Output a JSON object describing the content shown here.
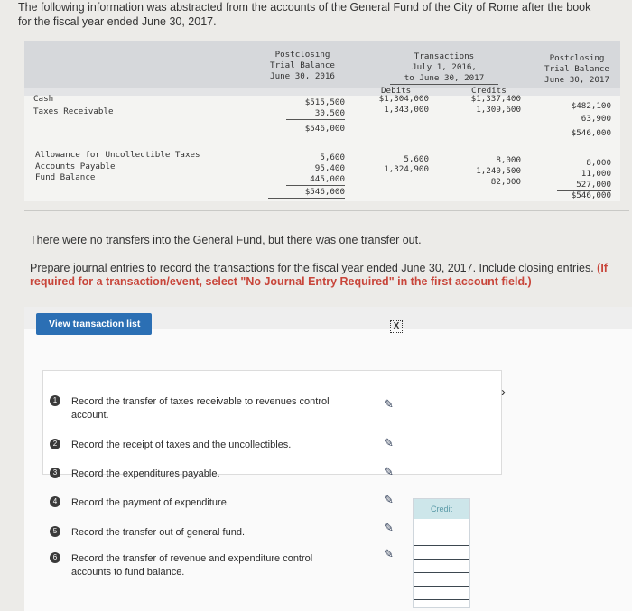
{
  "intro": {
    "line1": "The following information was abstracted from the accounts of the General Fund of the City of Rome after the book",
    "line2": "for the fiscal year ended June 30, 2017."
  },
  "trial_balance": {
    "head_left": [
      "Postclosing",
      "Trial Balance",
      "June 30, 2016"
    ],
    "head_mid": [
      "Transactions",
      "July 1, 2016,",
      "to June 30, 2017"
    ],
    "head_right": [
      "Postclosing",
      "Trial Balance",
      "June 30, 2017"
    ],
    "debits": "Debits",
    "credits": "Credits",
    "rows": [
      {
        "label": "Cash",
        "pre": "$515,500",
        "dr": "$1,304,000",
        "cr": "$1,337,400",
        "post": "$482,100"
      },
      {
        "label": "Taxes Receivable",
        "pre": "30,500",
        "dr": "1,343,000",
        "cr": "1,309,600",
        "post": "63,900"
      },
      {
        "label": "",
        "pre": "$546,000",
        "dr": "",
        "cr": "",
        "post": "$546,000"
      },
      {
        "label": "Allowance for Uncollectible Taxes",
        "pre": "5,600",
        "dr": "5,600",
        "cr": "8,000",
        "post": "8,000"
      },
      {
        "label": "Accounts Payable",
        "pre": "95,400",
        "dr": "1,324,900",
        "cr": "1,240,500",
        "post": "11,000"
      },
      {
        "label": "Fund Balance",
        "pre": "445,000",
        "dr": "",
        "cr": "82,000",
        "post": "527,000"
      },
      {
        "label": "",
        "pre": "$546,000",
        "dr": "",
        "cr": "",
        "post": "$546,000"
      }
    ]
  },
  "para1": "There were no transfers into the General Fund, but there was one transfer out.",
  "para2_text": "Prepare journal entries to record the transactions for the fiscal year ended June 30, 2017. Include closing entries.",
  "para2_bold": "(If required for a transaction/event, select \"No Journal Entry Required\" in the first account field.)",
  "panel": {
    "view_button": "View transaction list",
    "close_icon": "X",
    "credit_label": "Credit",
    "items": [
      {
        "num": "1",
        "text": "Record the transfer of taxes receivable to revenues control account."
      },
      {
        "num": "2",
        "text": "Record the receipt of taxes and the uncollectibles."
      },
      {
        "num": "3",
        "text": "Record the expenditures payable."
      },
      {
        "num": "4",
        "text": "Record the payment of expenditure."
      },
      {
        "num": "5",
        "text": "Record the transfer out of general fund."
      },
      {
        "num": "6",
        "text": "Record the transfer of revenue and expenditure control accounts to fund balance."
      }
    ]
  }
}
